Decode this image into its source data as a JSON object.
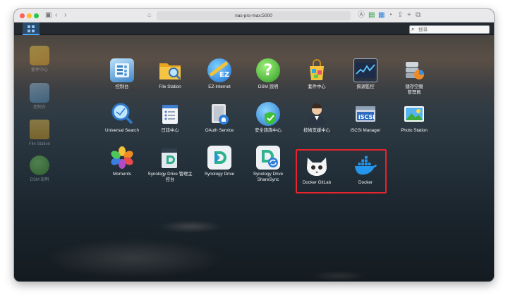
{
  "browser": {
    "address": "nas-pro-max:5000"
  },
  "search": {
    "placeholder": "搜尋"
  },
  "desktop_shortcuts": [
    {
      "label": "套件中心",
      "icon": "package-center-icon"
    },
    {
      "label": "控制台",
      "icon": "control-panel-icon"
    },
    {
      "label": "File Station",
      "icon": "folder-icon"
    },
    {
      "label": "DSM 說明",
      "icon": "help-icon"
    }
  ],
  "apps": [
    {
      "label": "控制台",
      "icon": "control-panel-icon"
    },
    {
      "label": "File Station",
      "icon": "folder-search-icon"
    },
    {
      "label": "EZ-Internet",
      "icon": "ez-internet-icon"
    },
    {
      "label": "DSM 說明",
      "icon": "help-icon"
    },
    {
      "label": "套件中心",
      "icon": "shopping-bag-icon"
    },
    {
      "label": "資源監控",
      "icon": "resource-monitor-icon"
    },
    {
      "label": "儲存空間\n管理員",
      "icon": "storage-manager-icon"
    },
    {
      "label": "Universal Search",
      "icon": "magnifier-icon"
    },
    {
      "label": "日誌中心",
      "icon": "log-center-icon"
    },
    {
      "label": "OAuth Service",
      "icon": "oauth-lock-icon"
    },
    {
      "label": "安全諮詢中心",
      "icon": "security-advisor-icon"
    },
    {
      "label": "技術支援中心",
      "icon": "support-agent-icon"
    },
    {
      "label": "iSCSI Manager",
      "icon": "iscsi-icon"
    },
    {
      "label": "Photo Station",
      "icon": "photo-icon"
    },
    {
      "label": "Moments",
      "icon": "moments-flower-icon"
    },
    {
      "label": "Synology Drive 管理主\n控台",
      "icon": "drive-admin-icon"
    },
    {
      "label": "Synology Drive",
      "icon": "drive-icon"
    },
    {
      "label": "Synology Drive\nShareSync",
      "icon": "drive-sharesync-icon"
    },
    {
      "label": "Docker GitLab",
      "icon": "gitlab-cat-icon"
    },
    {
      "label": "Docker",
      "icon": "docker-whale-icon"
    }
  ],
  "colors": {
    "highlight": "#e8242c",
    "accent": "#4da3ff"
  }
}
